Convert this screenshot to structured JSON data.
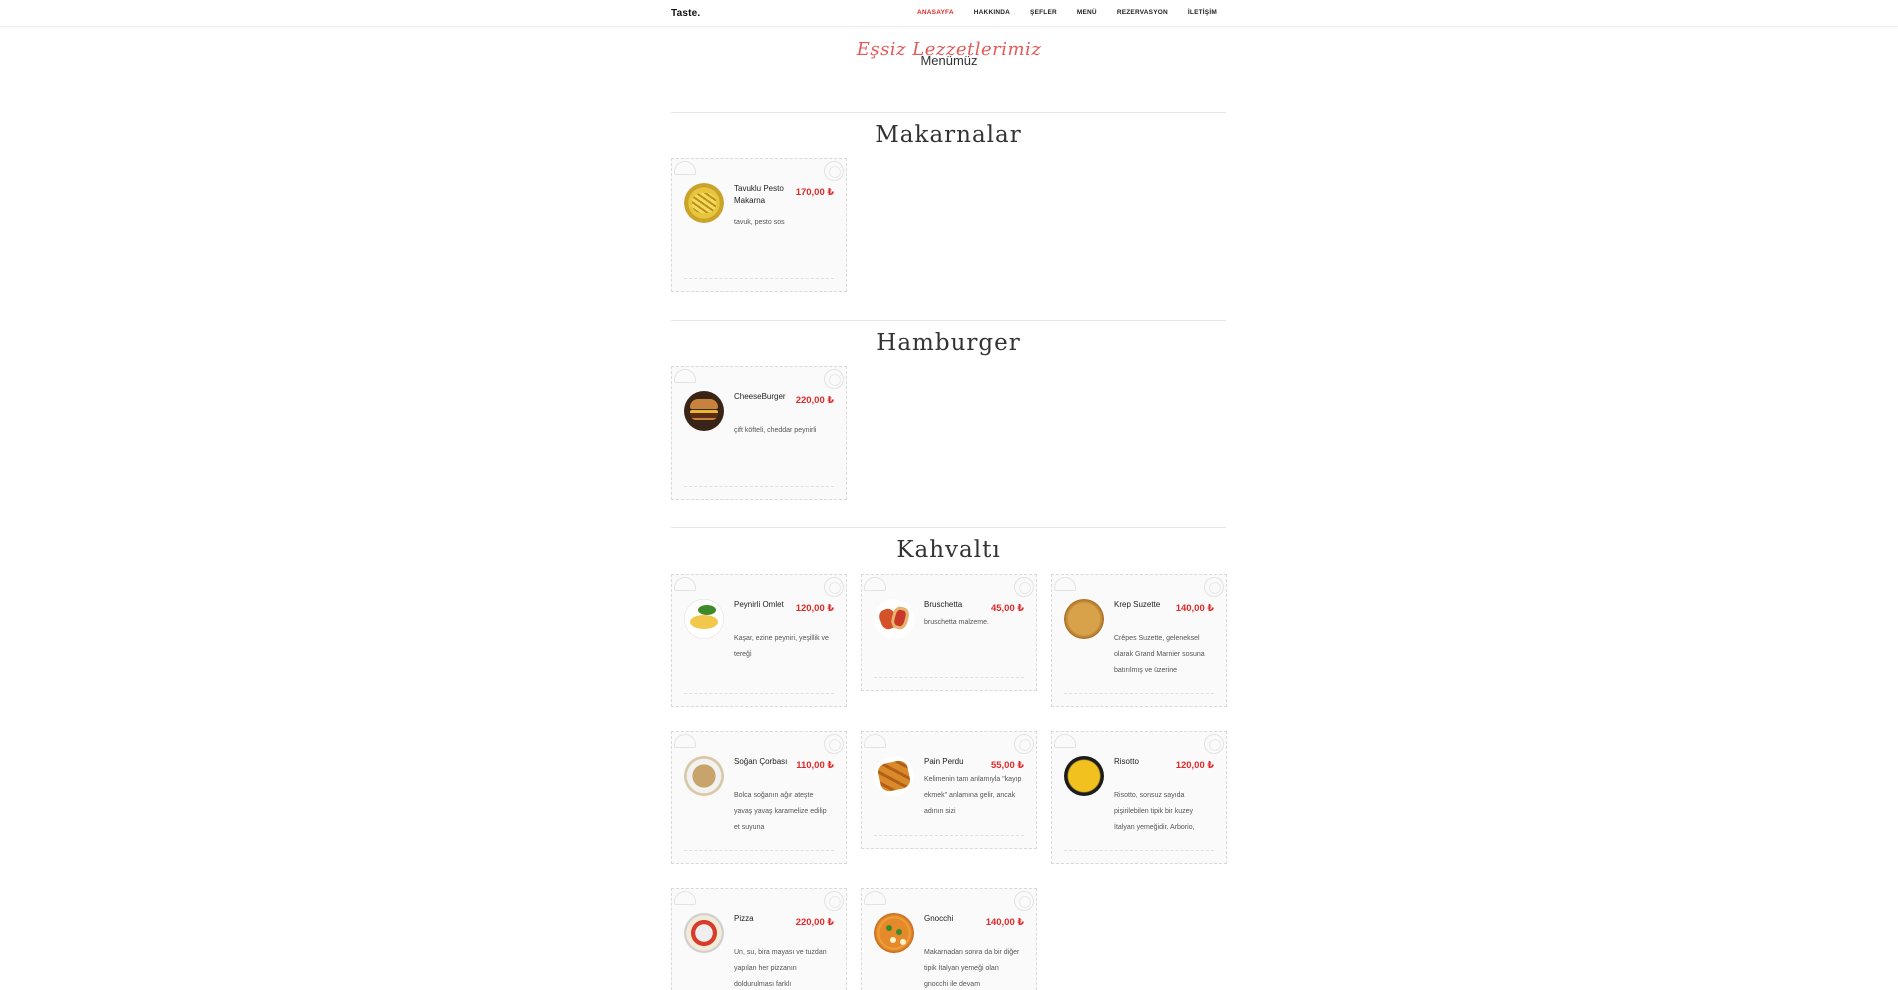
{
  "navbar": {
    "brand": "Taste.",
    "items": [
      {
        "label": "ANASAYFA",
        "active": true
      },
      {
        "label": "HAKKINDA",
        "active": false
      },
      {
        "label": "ŞEFLER",
        "active": false
      },
      {
        "label": "MENÜ",
        "active": false
      },
      {
        "label": "REZERVASYON",
        "active": false
      },
      {
        "label": "İLETİŞİM",
        "active": false
      }
    ]
  },
  "header": {
    "subtitle": "Eşsiz Lezzetlerimiz",
    "title": "Menümüz"
  },
  "sections": [
    {
      "title": "Makarnalar",
      "items": [
        {
          "name": "Tavuklu Pesto Makarna",
          "price": "170,00 ₺",
          "desc": "tavuk, pesto sos",
          "image_icon": "pasta-icon"
        }
      ]
    },
    {
      "title": "Hamburger",
      "items": [
        {
          "name": "CheeseBurger",
          "price": "220,00 ₺",
          "desc": "çift köfteli, cheddar peynirli",
          "image_icon": "burger-icon"
        }
      ]
    },
    {
      "title": "Kahvaltı",
      "items": [
        {
          "name": "Peynirli Omlet",
          "price": "120,00 ₺",
          "desc": "Kaşar, ezine peyniri, yeşillik ve tereği",
          "image_icon": "omelet-icon"
        },
        {
          "name": "Bruschetta",
          "price": "45,00 ₺",
          "desc": "bruschetta malzeme.",
          "image_icon": "bruschetta-icon"
        },
        {
          "name": "Krep Suzette",
          "price": "140,00 ₺",
          "desc": "Crêpes Suzette, geleneksel olarak Grand Marnier sosuna batırılmış ve üzerine",
          "image_icon": "crepe-icon"
        },
        {
          "name": "Soğan Çorbası",
          "price": "110,00 ₺",
          "desc": "Bolca soğanın ağır ateşte yavaş yavaş karamelize edilip et suyuna",
          "image_icon": "soup-icon"
        },
        {
          "name": "Pain Perdu",
          "price": "55,00 ₺",
          "desc": "Kelimenin tam anlamıyla \"kayıp ekmek\" anlamına gelir, ancak adının sizi",
          "image_icon": "french-toast-icon"
        },
        {
          "name": "Risotto",
          "price": "120,00 ₺",
          "desc": "Risotto, sonsuz sayıda pişirilebilen tipik bir kuzey İtalyan yemeğidir. Arborio,",
          "image_icon": "risotto-icon"
        },
        {
          "name": "Pizza",
          "price": "220,00 ₺",
          "desc": "Un, su, bira mayası ve tuzdan yapılan her pizzanın doldurulması farklı",
          "image_icon": "pizza-icon"
        },
        {
          "name": "Gnocchi",
          "price": "140,00 ₺",
          "desc": "Makarnadan sonra da bir diğer tipik İtalyan yemeği olan gnocchi ile devam",
          "image_icon": "gnocchi-icon"
        }
      ]
    }
  ]
}
